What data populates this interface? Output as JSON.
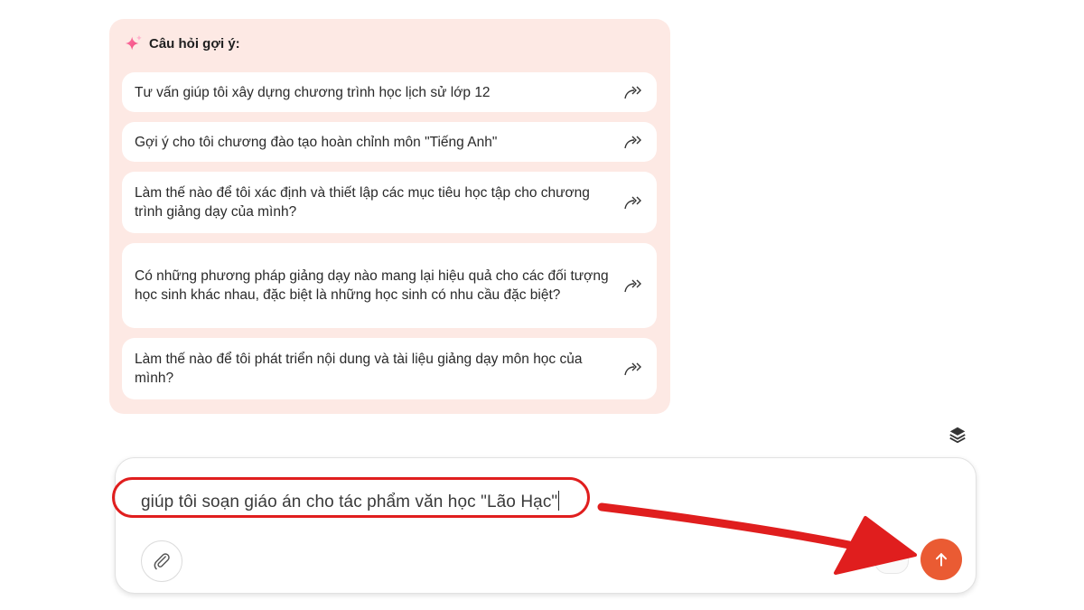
{
  "suggestions": {
    "header": "Câu hỏi gợi ý:",
    "items": [
      {
        "text": "Tư vấn giúp tôi xây dựng chương trình học lịch sử lớp 12"
      },
      {
        "text": "Gợi ý cho tôi chương đào tạo hoàn chỉnh môn \"Tiếng Anh\""
      },
      {
        "text": "Làm thế nào để tôi xác định và thiết lập các mục tiêu học tập cho chương trình giảng dạy của mình?"
      },
      {
        "text": "Có những phương pháp giảng dạy nào mang lại hiệu quả cho các đối tượng học sinh khác nhau, đặc biệt là những học sinh có nhu cầu đặc biệt?"
      },
      {
        "text": "Làm thế nào để tôi phát triển nội dung và tài liệu giảng dạy môn học của mình?"
      }
    ]
  },
  "composer": {
    "value": "giúp tôi soạn giáo án cho tác phẩm văn học \"Lão Hạc\""
  },
  "icons": {
    "sparkle": "sparkle-icon",
    "forward": "forward-arrow-icon",
    "layers": "layers-icon",
    "attach": "paperclip-icon",
    "send": "arrow-up-icon"
  },
  "colors": {
    "panel_bg": "#fde9e4",
    "send_button": "#ea5b33",
    "annotation": "#e01e1e"
  }
}
